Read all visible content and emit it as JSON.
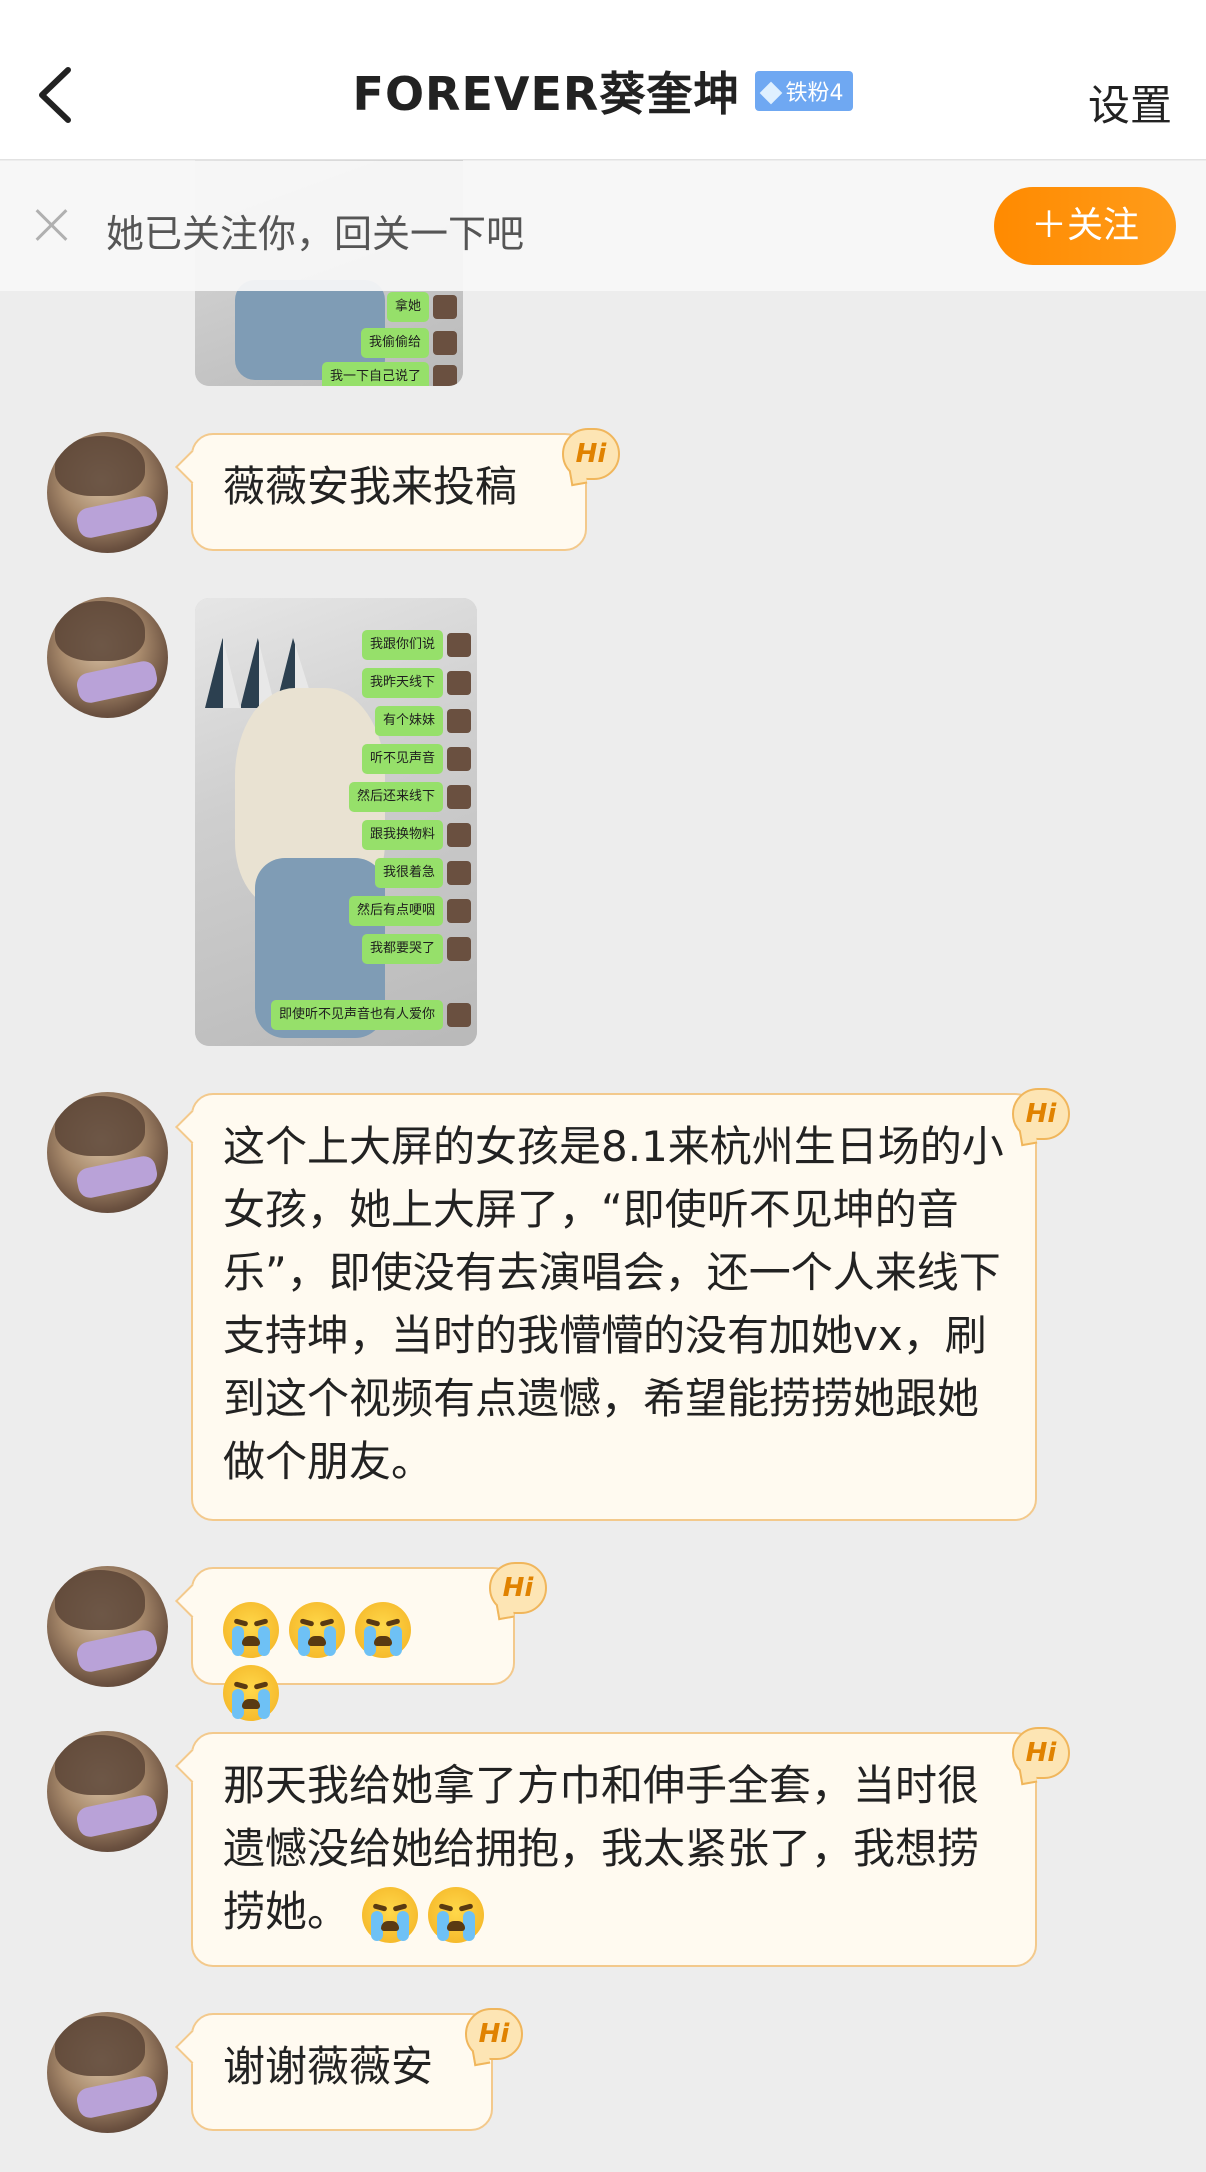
{
  "header": {
    "title": "FOREVER葵奎坤",
    "fan_badge": "铁粉4",
    "settings_label": "设置"
  },
  "follow_bar": {
    "text": "她已关注你，回关一下吧",
    "button_label": "＋关注"
  },
  "hi_label": "Hi",
  "messages": {
    "msg1": "薇薇安我来投稿",
    "msg3": "这个上大屏的女孩是8.1来杭州生日场的小女孩，她上大屏了，“即使听不见坤的音乐”，即使没有去演唱会，还一个人来线下支持坤，当时的我懵懵的没有加她vx，刷到这个视频有点遗憾，希望能捞捞她跟她做个朋友。",
    "msg5_text": "那天我给她拿了方巾和伸手全套，当时很遗憾没给她给拥抱，我太紧张了，我想捞捞她。",
    "msg6": "谢谢薇薇安"
  },
  "image_top": {
    "bubbles": [
      "拿她",
      "我偷偷给",
      "我一下自己说了"
    ]
  },
  "image_main": {
    "bubbles": [
      "我跟你们说",
      "我昨天线下",
      "有个妹妹",
      "听不见声音",
      "然后还来线下",
      "跟我换物料",
      "我很着急",
      "然后有点哽咽",
      "我都要哭了",
      "即使听不见声音也有人爱你"
    ]
  },
  "emojis": {
    "msg4_count": 4,
    "msg5_count": 2,
    "name": "loudly-crying-face"
  },
  "colors": {
    "accent_orange": "#ff8a00",
    "bubble_bg": "#fffaf0",
    "bubble_border": "#f3c98c",
    "badge_blue": "#6fa8f2",
    "chat_bg": "#ededed"
  }
}
